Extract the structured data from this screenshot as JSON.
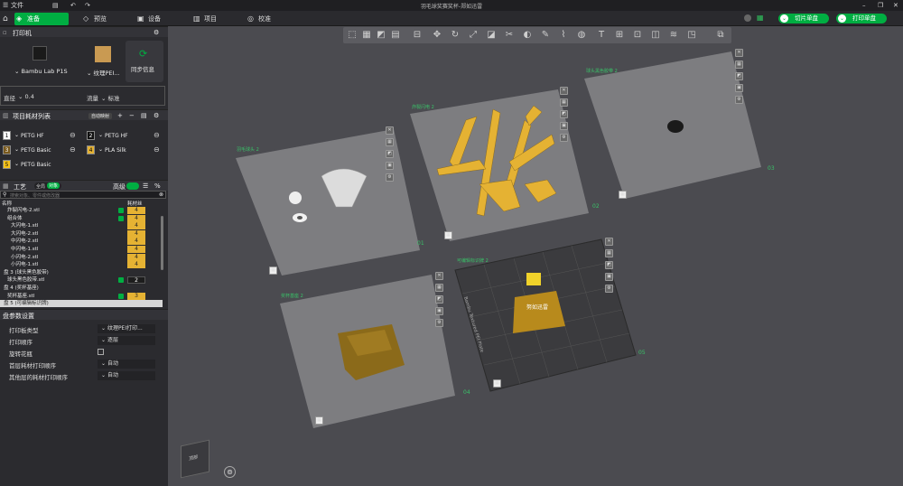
{
  "titlebar": {
    "file_menu": "文件",
    "title": "羽毛球奖赛奖杯-郑如迅雷"
  },
  "tabs": [
    {
      "label": "准备"
    },
    {
      "label": "预览"
    },
    {
      "label": "设备"
    },
    {
      "label": "项目"
    },
    {
      "label": "校准"
    }
  ],
  "actions": {
    "slice": "切片单盘",
    "print": "打印单盘"
  },
  "printer": {
    "section": "打印机",
    "name": "Bambu Lab P1S",
    "plate": "纹理PEI...",
    "sync": "同步信息",
    "nozzle_label": "直径",
    "nozzle_value": "0.4",
    "flow_label": "流量",
    "flow_value": "标准"
  },
  "filaments": {
    "section": "项目耗材列表",
    "auto_btn": "自动映射",
    "items": [
      {
        "num": "1",
        "name": "PETG HF",
        "color": "#ffffff"
      },
      {
        "num": "2",
        "name": "PETG HF",
        "color": "#111111"
      },
      {
        "num": "3",
        "name": "PETG Basic",
        "color": "#7a5a1e"
      },
      {
        "num": "4",
        "name": "PLA Silk",
        "color": "#e5b233"
      },
      {
        "num": "5",
        "name": "PETG Basic",
        "color": "#f6c21a"
      }
    ]
  },
  "process": {
    "section": "工艺",
    "global": "全局",
    "object": "对象",
    "advanced": "高级",
    "search_placeholder": "搜索对象、零件或修改器",
    "col_name": "名称",
    "col_fil": "耗材丝",
    "rows": [
      {
        "indent": 8,
        "name": "炸裂闪电-2.stl",
        "cb": true,
        "fil": "4"
      },
      {
        "indent": 8,
        "name": "组合体",
        "cb": true,
        "fil": "4"
      },
      {
        "indent": 12,
        "name": "大闪电-1.stl",
        "cb": false,
        "fil": "4"
      },
      {
        "indent": 12,
        "name": "大闪电-2.stl",
        "cb": false,
        "fil": "4"
      },
      {
        "indent": 12,
        "name": "中闪电-2.stl",
        "cb": false,
        "fil": "4"
      },
      {
        "indent": 12,
        "name": "中闪电-1.stl",
        "cb": false,
        "fil": "4"
      },
      {
        "indent": 12,
        "name": "小闪电-2.stl",
        "cb": false,
        "fil": "4"
      },
      {
        "indent": 12,
        "name": "小闪电-1.stl",
        "cb": false,
        "fil": "4"
      },
      {
        "indent": 4,
        "name": "盘 3 (球头黑色胶带)",
        "cb": false,
        "fil": ""
      },
      {
        "indent": 8,
        "name": "球头黑色胶带.stl",
        "cb": true,
        "fil": "2",
        "dark": true
      },
      {
        "indent": 4,
        "name": "盘 4 (奖杯基座)",
        "cb": false,
        "fil": ""
      },
      {
        "indent": 8,
        "name": "奖杯基座.stl",
        "cb": true,
        "fil": "3"
      },
      {
        "indent": 4,
        "name": "盘 5 (可编辑标识牌)",
        "cb": false,
        "fil": "",
        "selected": true
      }
    ]
  },
  "plate_settings": {
    "section": "盘参数设置",
    "params": [
      {
        "label": "打印板类型",
        "value": "纹理PEI打印..."
      },
      {
        "label": "打印顺序",
        "value": "逐层"
      },
      {
        "label": "旋转花瓶",
        "value": ""
      },
      {
        "label": "首层耗材打印顺序",
        "value": "自动"
      },
      {
        "label": "其他层的耗材打印顺序",
        "value": "自动"
      }
    ]
  },
  "plates": [
    {
      "label": "羽毛球头 2",
      "num": "01"
    },
    {
      "label": "炸裂闪电 2",
      "num": "02"
    },
    {
      "label": "球头黑色胶带 2",
      "num": "03"
    },
    {
      "label": "奖杯基座 2",
      "num": "04"
    },
    {
      "label": "可编辑标识牌 2",
      "num": "05"
    }
  ],
  "plate5_text": {
    "bed": "Bambu Textured PEI Plate",
    "sign": "努如迅雷"
  },
  "cube": {
    "label": "顶部"
  },
  "colors": {
    "accent": "#00ae42",
    "gold": "#e5b233"
  }
}
